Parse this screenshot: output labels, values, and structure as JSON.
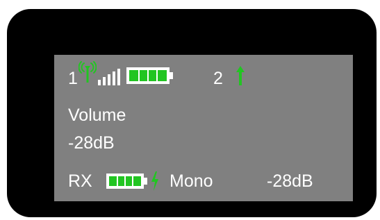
{
  "status_row": {
    "channel_1": "1",
    "channel_2": "2",
    "signal_bars": 5,
    "signal_bars_lit": 4,
    "tx_battery_level": 1.0
  },
  "main": {
    "parameter_label": "Volume",
    "parameter_value": "-28dB"
  },
  "footer": {
    "rx_label": "RX",
    "rx_battery_level": 1.0,
    "mode": "Mono",
    "level": "-28dB"
  },
  "colors": {
    "screen": "#808080",
    "text": "#ffffff",
    "accent": "#22c522",
    "bezel": "#000000"
  },
  "icons": [
    "antenna-icon",
    "signal-strength-icon",
    "tx-battery-icon",
    "upload-arrow-icon",
    "rx-battery-icon",
    "charging-bolt-icon"
  ]
}
